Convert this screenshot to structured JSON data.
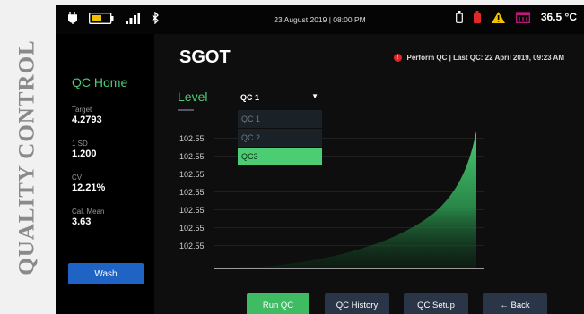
{
  "side_title": "QUALITY CONTROL",
  "statusbar": {
    "datetime": "23 August 2019 | 08:00 PM",
    "temperature": "36.5 °C",
    "left_icons": [
      "plug-icon",
      "battery-icon",
      "signal-icon",
      "bluetooth-icon"
    ],
    "right_icons": [
      "reagent-bottle-icon",
      "waste-bottle-icon",
      "warning-icon",
      "calendar-icon"
    ]
  },
  "sidebar": {
    "heading": "QC Home",
    "stats": [
      {
        "label": "Target",
        "value": "4.2793"
      },
      {
        "label": "1 SD",
        "value": "1.200"
      },
      {
        "label": "CV",
        "value": "12.21%"
      },
      {
        "label": "Cal. Mean",
        "value": "3.63"
      }
    ],
    "wash_label": "Wash"
  },
  "main": {
    "title": "SGOT",
    "alert_icon": "!",
    "alert_text": "Perform QC | Last QC: 22 April 2019, 09:23 AM",
    "level_label": "Level",
    "dropdown": {
      "selected": "QC 1",
      "options": [
        "QC 1",
        "QC 2",
        "QC3"
      ],
      "highlighted": "QC3"
    },
    "y_ticks": [
      "102.55",
      "102.55",
      "102.55",
      "102.55",
      "102.55",
      "102.55",
      "102.55"
    ]
  },
  "chart_data": {
    "type": "area",
    "y_tick_labels": [
      "102.55",
      "102.55",
      "102.55",
      "102.55",
      "102.55",
      "102.55",
      "102.55"
    ],
    "grid": true
  },
  "buttons": {
    "run_qc": "Run QC",
    "qc_history": "QC History",
    "qc_setup": "QC Setup",
    "back": "← Back"
  },
  "colors": {
    "accent_green": "#4ccd74",
    "wash_blue": "#1f63c4",
    "button_dark": "#2a3548",
    "alert_red": "#e02828"
  }
}
